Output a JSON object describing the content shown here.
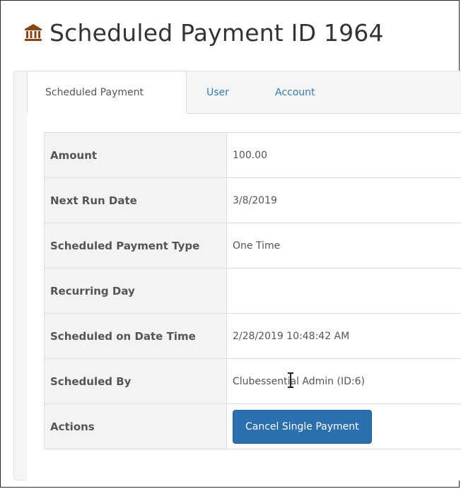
{
  "header": {
    "title": "Scheduled Payment ID 1964",
    "icon": "bank-icon",
    "icon_color": "#8b4513"
  },
  "tabs": [
    {
      "label": "Scheduled Payment",
      "active": true
    },
    {
      "label": "User",
      "active": false
    },
    {
      "label": "Account",
      "active": false
    }
  ],
  "details": {
    "rows": [
      {
        "label": "Amount",
        "value": "100.00"
      },
      {
        "label": "Next Run Date",
        "value": "3/8/2019"
      },
      {
        "label": "Scheduled Payment Type",
        "value": "One Time"
      },
      {
        "label": "Recurring Day",
        "value": ""
      },
      {
        "label": "Scheduled on Date Time",
        "value": "2/28/2019 10:48:42 AM"
      },
      {
        "label": "Scheduled By",
        "value": "Clubessential Admin (ID:6)"
      },
      {
        "label": "Actions",
        "value": ""
      }
    ],
    "actions": {
      "cancel_button_label": "Cancel Single Payment"
    }
  },
  "colors": {
    "button": "#2a6fae",
    "link": "#2f7bb5",
    "label_bg": "#f3f3f3"
  }
}
